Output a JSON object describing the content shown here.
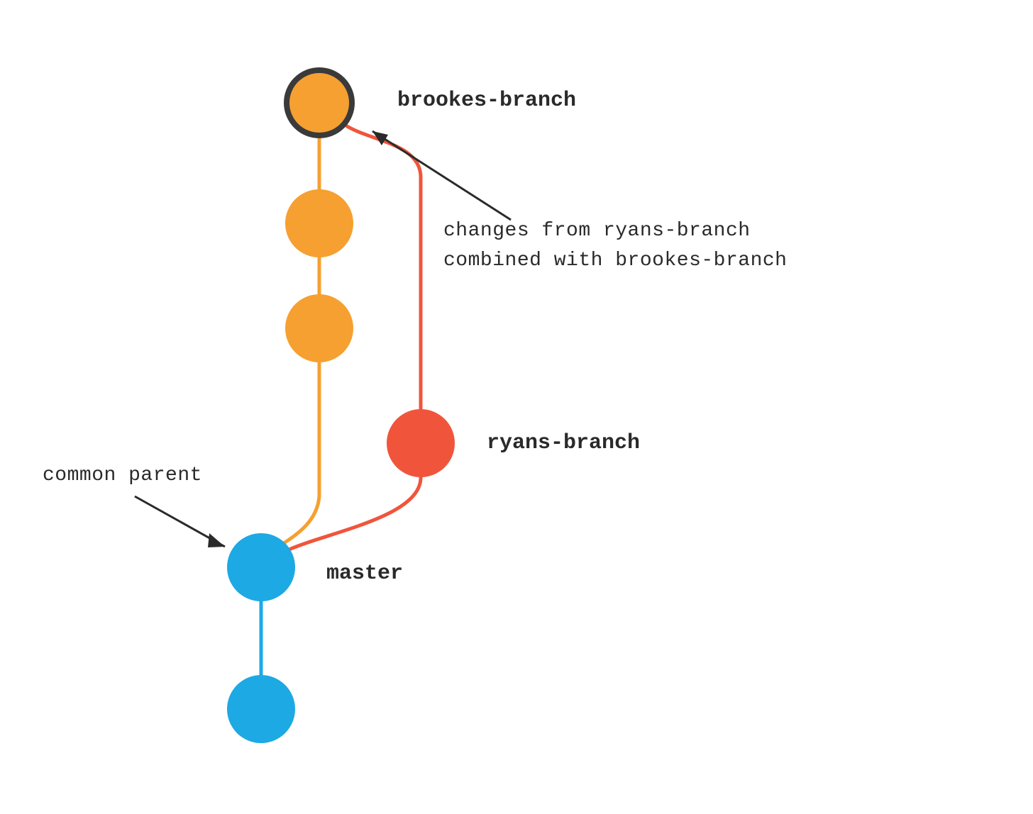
{
  "colors": {
    "blue": "#1DA9E3",
    "orange": "#F5A031",
    "red": "#F0553B",
    "outline": "#3A3A3A",
    "text": "#2A2A2A"
  },
  "branches": {
    "brookes": {
      "label": "brookes-branch",
      "commits": 3
    },
    "ryans": {
      "label": "ryans-branch",
      "commits": 1
    },
    "master": {
      "label": "master",
      "commits": 2
    }
  },
  "annotations": {
    "merge": {
      "line1_pre": "changes from ",
      "line1_mono": "ryans-branch",
      "line2_pre": "combined with ",
      "line2_mono": "brookes-branch"
    },
    "parent": "common parent"
  }
}
